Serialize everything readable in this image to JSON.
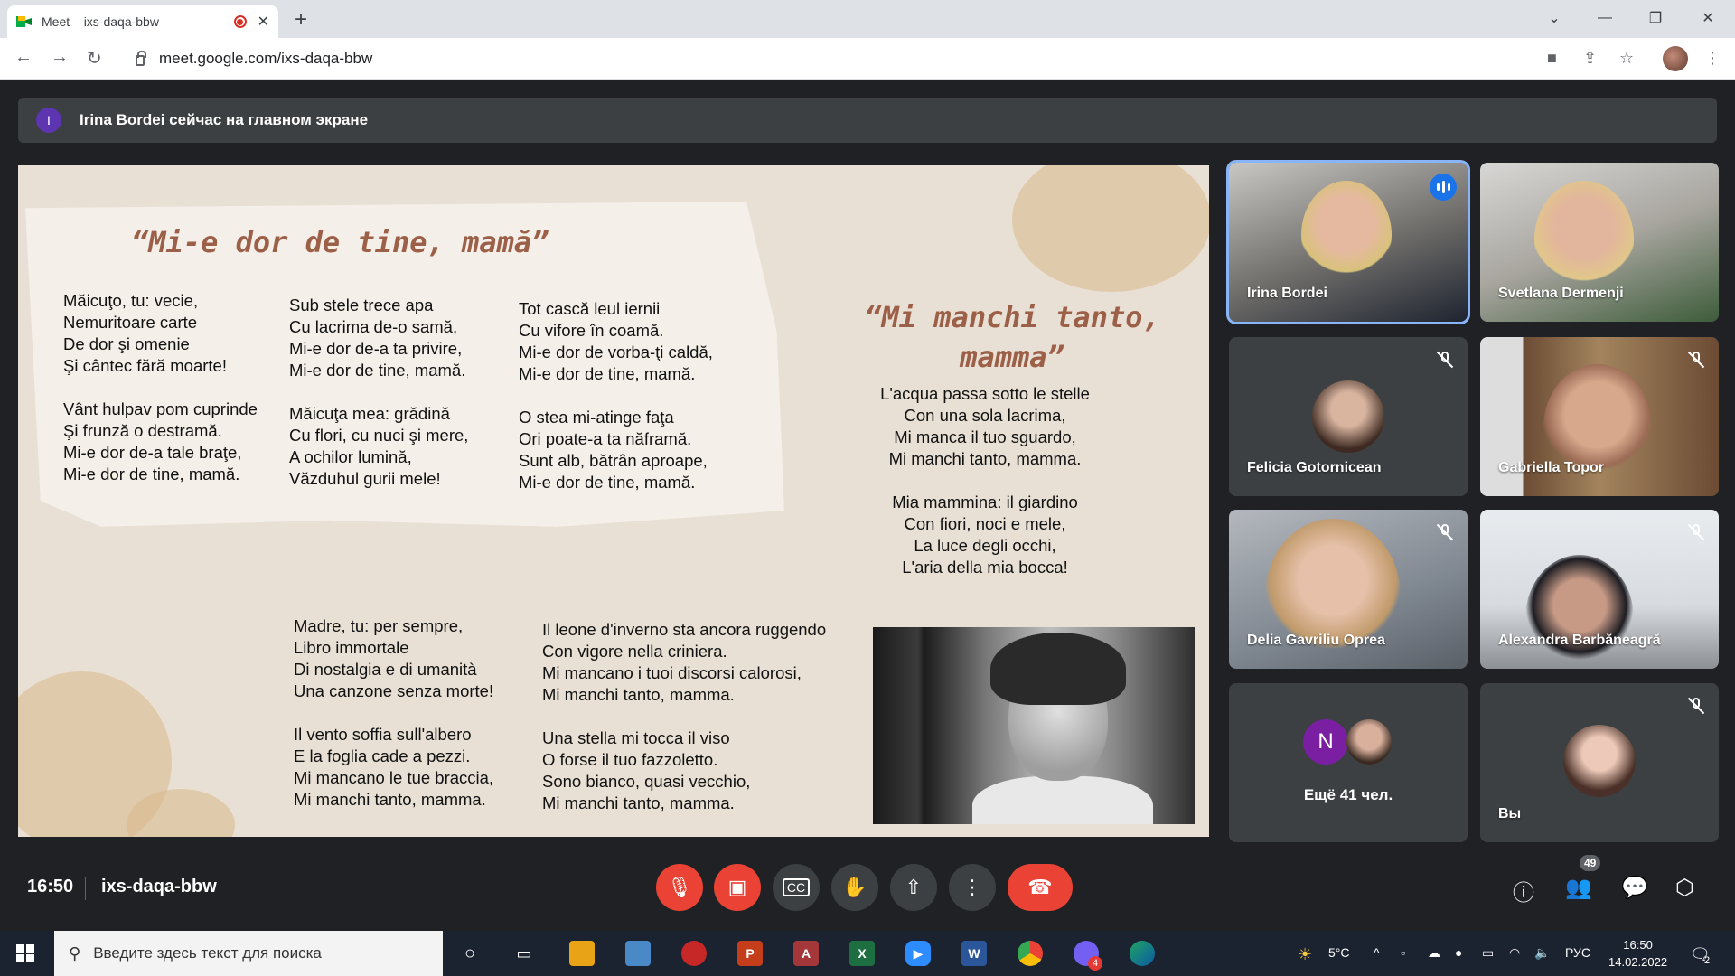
{
  "browser": {
    "tab_title": "Meet – ixs-daqa-bbw",
    "url": "meet.google.com/ixs-daqa-bbw"
  },
  "banner": {
    "avatar_letter": "I",
    "text": "Irina Bordei сейчас на главном экране"
  },
  "slide": {
    "title1": "“Mi-e dor de tine, mamă”",
    "title2": "“Mi manchi tanto,\nmamma”",
    "ro_col1": "Măicuţo, tu: vecie,\nNemuritoare carte\nDe dor şi omenie\nŞi cântec fără moarte!\n\nVânt hulpav pom cuprinde\nŞi frunză o destramă.\nMi-e dor de-a tale braţe,\nMi-e dor de tine, mamă.",
    "ro_col2": "Sub stele trece apa\nCu lacrima de-o samă,\nMi-e dor de-a ta privire,\nMi-e dor de tine, mamă.\n\nMăicuţa mea: grădină\nCu flori, cu nuci şi mere,\nA ochilor lumină,\nVăzduhul gurii mele!",
    "ro_col3": "Tot cască leul iernii\nCu vifore în coamă.\nMi-e dor de vorba-ţi caldă,\nMi-e dor de tine, mamă.\n\nO stea mi-atinge faţa\nOri poate-a ta năframă.\nSunt alb, bătrân aproape,\nMi-e dor de tine, mamă.",
    "it_right": "L'acqua passa sotto le stelle\nCon una sola lacrima,\nMi manca il tuo sguardo,\nMi manchi tanto,  mamma.\n\nMia mammina: il giardino\nCon fiori, noci e mele,\nLa luce degli occhi,\nL'aria della mia bocca!",
    "it_col1": "Madre, tu: per sempre,\nLibro immortale\nDi nostalgia e di umanità\nUna canzone senza morte!\n\nIl vento soffia sull'albero\nE la foglia cade a pezzi.\nMi mancano le tue braccia,\nMi manchi tanto, mamma.",
    "it_col2": "Il leone d'inverno sta ancora ruggendo\nCon vigore nella criniera.\nMi mancano i tuoi discorsi calorosi,\nMi manchi tanto, mamma.\n\nUna stella mi tocca il viso\nO forse il tuo fazzoletto.\nSono bianco, quasi vecchio,\nMi manchi tanto, mamma."
  },
  "participants": [
    {
      "name": "Irina Bordei",
      "muted": false,
      "speaking": true
    },
    {
      "name": "Svetlana Dermenji",
      "muted": false
    },
    {
      "name": "Felicia Gotornicean",
      "muted": true
    },
    {
      "name": "Gabriella Topor",
      "muted": true
    },
    {
      "name": "Delia Gavriliu Oprea",
      "muted": true
    },
    {
      "name": "Alexandra Barbăneagră",
      "muted": true
    }
  ],
  "more_tile": {
    "avatar_letter": "N",
    "label": "Ещё 41 чел."
  },
  "self_tile": {
    "label": "Вы"
  },
  "bottombar": {
    "time": "16:50",
    "meeting_code": "ixs-daqa-bbw",
    "participants_count": "49"
  },
  "taskbar": {
    "search_placeholder": "Введите здесь текст для поиска",
    "weather": "5°C",
    "lang": "РУС",
    "clock_time": "16:50",
    "clock_date": "14.02.2022",
    "notif_count": "2",
    "viber_badge": "4"
  },
  "colors": {
    "accent_blue": "#1a73e8",
    "danger_red": "#ea4335",
    "meet_bg": "#202124"
  }
}
